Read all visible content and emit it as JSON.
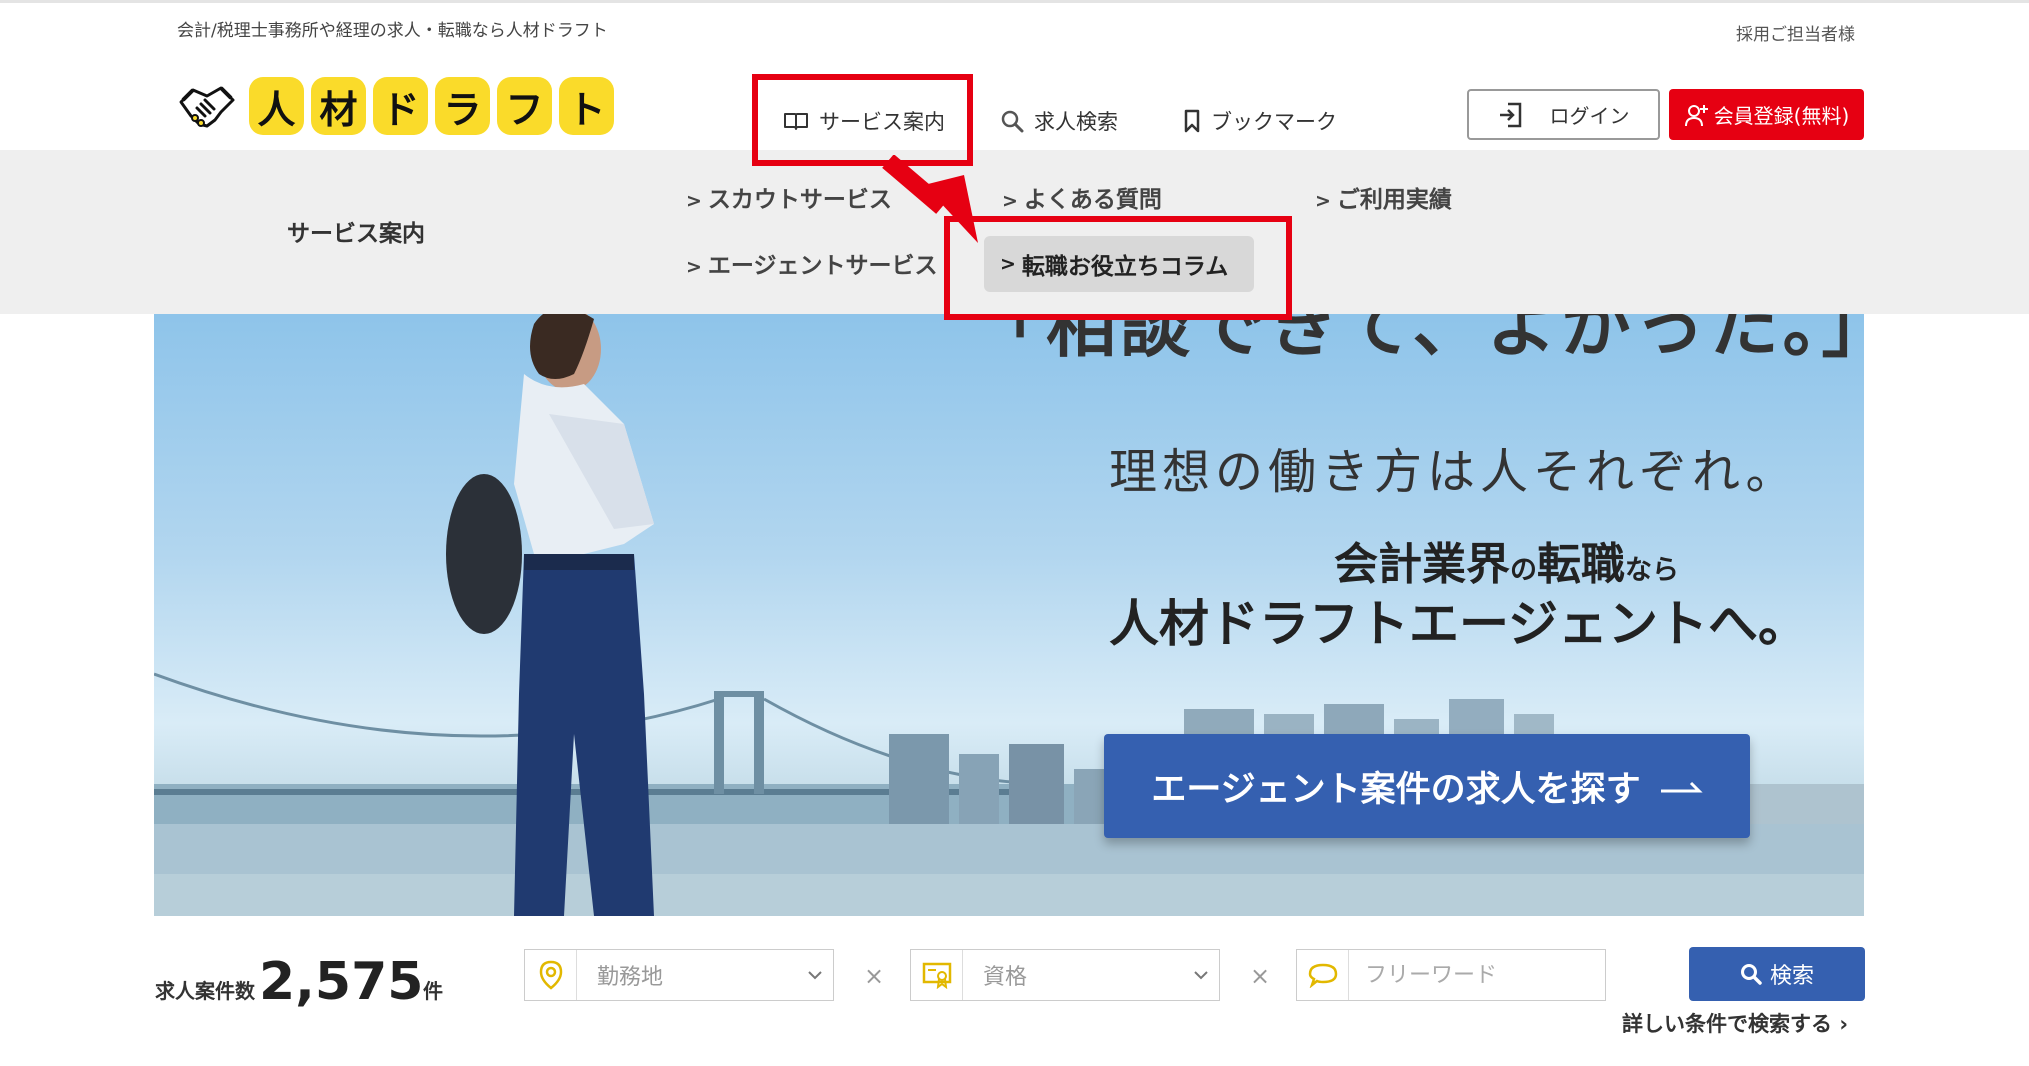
{
  "header": {
    "tagline": "会計/税理士事務所や経理の求人・転職なら人材ドラフト",
    "recruiter_link": "採用ご担当者様",
    "logo_chars": [
      "人",
      "材",
      "ド",
      "ラ",
      "フ",
      "ト"
    ],
    "nav": {
      "service": "サービス案内",
      "search": "求人検索",
      "bookmark": "ブックマーク"
    },
    "login_label": "ログイン",
    "register_label": "会員登録(無料)"
  },
  "dropdown": {
    "title": "サービス案内",
    "items": {
      "scout": "スカウトサービス",
      "faq": "よくある質問",
      "results": "ご利用実績",
      "agent": "エージェントサービス",
      "column": "転職お役立ちコラム"
    }
  },
  "hero": {
    "top_text": "「相談できて、よかった。」",
    "subtitle": "理想の働き方は人それぞれ。",
    "line1_a": "会計業界",
    "line1_b": "の",
    "line1_c": "転職",
    "line1_d": "なら",
    "line2": "人材ドラフトエージェントへ。",
    "cta": "エージェント案件の求人を探す"
  },
  "search": {
    "count_label": "求人案件数",
    "count_value": "2,575",
    "count_unit": "件",
    "area_placeholder": "勤務地",
    "qualification_placeholder": "資格",
    "freeword_placeholder": "フリーワード",
    "times": "×",
    "button_label": "検索",
    "detail_link": "詳しい条件で検索する"
  },
  "colors": {
    "logo_yellow": "#fadb2a",
    "register_red": "#e60012",
    "highlight_red": "#e60012",
    "primary_blue": "#3560b0",
    "dropdown_bg": "#efefef"
  },
  "icons": {
    "logo": "handshake-icon",
    "service": "book-icon",
    "search": "search-icon",
    "bookmark": "bookmark-icon",
    "login": "login-door-icon",
    "register": "user-plus-icon",
    "area": "map-pin-icon",
    "qualification": "certificate-icon",
    "freeword": "speech-bubble-icon"
  }
}
